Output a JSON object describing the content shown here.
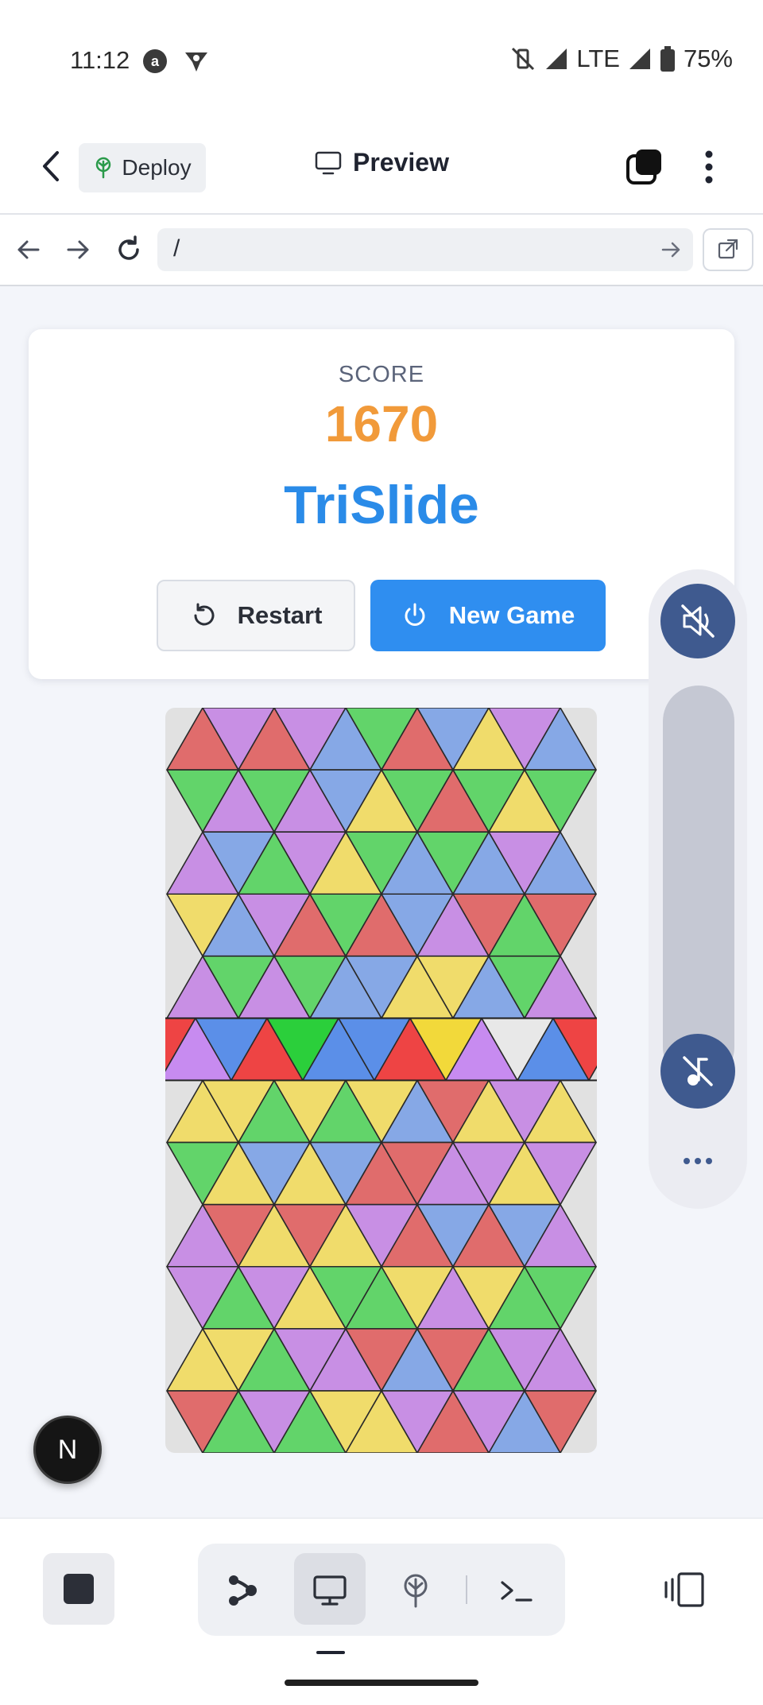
{
  "status_bar": {
    "time": "11:12",
    "network": "LTE",
    "battery": "75%"
  },
  "app_bar": {
    "deploy_label": "Deploy",
    "preview_label": "Preview"
  },
  "url_bar": {
    "url": "/"
  },
  "game": {
    "score_label": "SCORE",
    "score": "1670",
    "title": "TriSlide",
    "restart_label": "Restart",
    "new_game_label": "New Game",
    "colors": {
      "R": "#e06c6c",
      "P": "#c88fe4",
      "B": "#86a8e6",
      "G": "#62d46a",
      "Y": "#f0dc6b"
    },
    "selected_row_colors": {
      "R": "#ee4444",
      "P": "#c78bf0",
      "B": "#5b8fe8",
      "G": "#2bcf3b",
      "Y": "#f2d93a",
      "W": "#e8e8e8"
    },
    "selected_row": 5,
    "board_rows": [
      [
        "R",
        "P",
        "R",
        "P",
        "B",
        "G",
        "R",
        "B",
        "Y",
        "P",
        "B"
      ],
      [
        "G",
        "P",
        "G",
        "P",
        "B",
        "Y",
        "G",
        "R",
        "G",
        "Y",
        "G"
      ],
      [
        "P",
        "B",
        "G",
        "P",
        "Y",
        "G",
        "B",
        "G",
        "B",
        "P",
        "B"
      ],
      [
        "Y",
        "B",
        "P",
        "R",
        "G",
        "R",
        "B",
        "P",
        "R",
        "G",
        "R"
      ],
      [
        "P",
        "G",
        "P",
        "G",
        "B",
        "B",
        "Y",
        "Y",
        "B",
        "G",
        "P"
      ],
      [
        "R",
        "P",
        "B",
        "R",
        "G",
        "B",
        "B",
        "R",
        "Y",
        "P",
        "W",
        "B",
        "R"
      ],
      [
        "Y",
        "Y",
        "G",
        "Y",
        "G",
        "Y",
        "B",
        "R",
        "Y",
        "P",
        "Y"
      ],
      [
        "G",
        "Y",
        "B",
        "Y",
        "B",
        "R",
        "R",
        "P",
        "P",
        "Y",
        "P"
      ],
      [
        "P",
        "R",
        "Y",
        "R",
        "Y",
        "P",
        "R",
        "B",
        "R",
        "B",
        "P"
      ],
      [
        "P",
        "G",
        "P",
        "Y",
        "G",
        "G",
        "Y",
        "P",
        "Y",
        "G",
        "G"
      ],
      [
        "Y",
        "Y",
        "G",
        "P",
        "P",
        "R",
        "B",
        "R",
        "G",
        "P",
        "P"
      ],
      [
        "R",
        "G",
        "P",
        "G",
        "Y",
        "Y",
        "P",
        "R",
        "P",
        "B",
        "R"
      ]
    ]
  },
  "icons": {
    "back": "back-arrow-icon",
    "deploy": "deploy-tree-icon",
    "preview": "monitor-icon",
    "tabs": "tabs-icon",
    "more": "more-vert-icon",
    "nav_back": "arrow-left-icon",
    "nav_forward": "arrow-right-icon",
    "reload": "reload-icon",
    "go": "arrow-right-icon",
    "open_external": "open-external-icon",
    "restart": "restart-icon",
    "power": "power-icon",
    "mute": "mute-icon",
    "note": "music-note-off-icon",
    "more_horiz": "more-horiz-icon",
    "stop": "stop-icon",
    "agent": "agent-icon",
    "desktop": "desktop-icon",
    "deploy_tab": "deploy-tree-icon",
    "terminal": "terminal-icon",
    "rotate": "rotate-device-icon"
  },
  "next_badge": "N"
}
